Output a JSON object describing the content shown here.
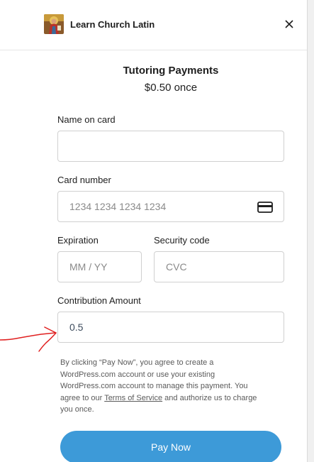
{
  "header": {
    "site_name": "Learn Church Latin",
    "logo_icon": "saint-portrait-icon",
    "close_label": "×"
  },
  "product": {
    "title": "Tutoring Payments",
    "price": "$0.50 once"
  },
  "form": {
    "name_label": "Name on card",
    "name_value": "",
    "card_number_label": "Card number",
    "card_number_placeholder": "1234 1234 1234 1234",
    "card_icon": "credit-card-icon",
    "expiration_label": "Expiration",
    "expiration_placeholder": "MM / YY",
    "security_label": "Security code",
    "security_placeholder": "CVC",
    "amount_label": "Contribution Amount",
    "amount_value": "0.5"
  },
  "disclaimer": {
    "before_link": "By clicking “Pay Now”, you agree to create a WordPress.com account or use your existing WordPress.com account to manage this payment. You agree to our",
    "link_text": "Terms of Service",
    "after_link": "and authorize us to charge you once."
  },
  "actions": {
    "pay_label": "Pay Now"
  },
  "colors": {
    "button": "#3d9ad8",
    "annotation_arrow": "#e02020"
  }
}
